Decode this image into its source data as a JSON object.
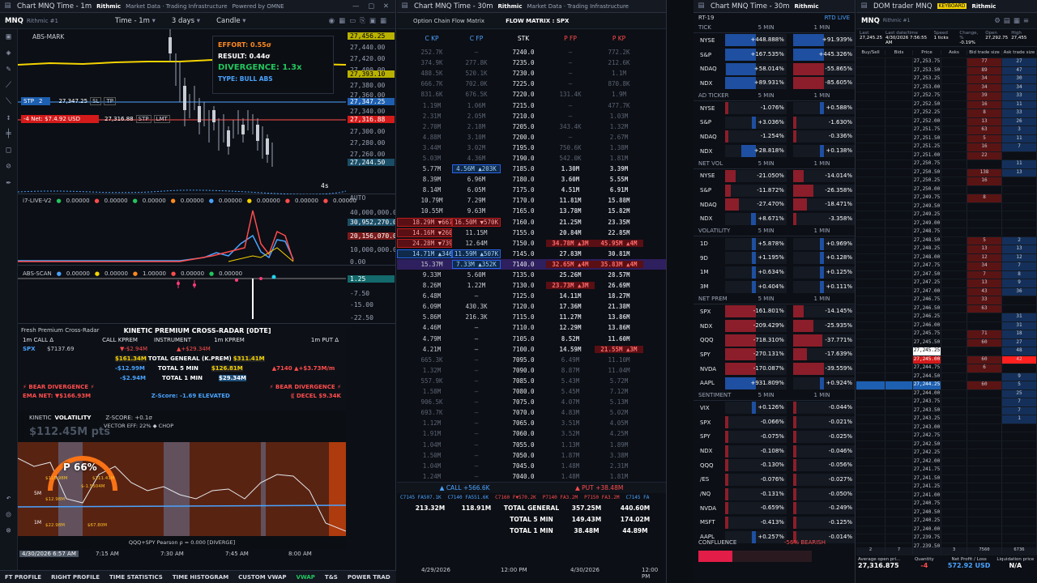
{
  "colors": {
    "accent": "#4aa3ff",
    "bear": "#ff4c4c",
    "bull": "#22c55e",
    "divergence": "#f5d300"
  },
  "left": {
    "title": "Chart MNQ Time - 1m",
    "brand": "Rithmic",
    "brand2": "Market Data · Trading Infrastructure",
    "powered": "Powered by OMNE",
    "symbol": "MNQ",
    "account": "Rithmic #1",
    "toolbar": {
      "interval": "Time - 1m",
      "range": "3 days",
      "style": "Candle"
    },
    "overlay": {
      "name": "ABS-MARK",
      "effort": "EFFORT: 0.55σ",
      "result": "RESULT: 0.44σ",
      "divergence": "DIVERGENCE: 1.3x",
      "type": "TYPE: BULL ABS"
    },
    "stp": {
      "label": "STP",
      "qty": "2",
      "price": "27,347.25",
      "sl": "SL",
      "tp": "TP"
    },
    "lmt": {
      "label": "-4 Net: $7.4.92 USD",
      "price": "27,316.88",
      "stp": "STP",
      "lmt": "LMT"
    },
    "price_axis": [
      "27,456.25",
      "27,440.00",
      "27,420.00",
      "27,400.00",
      "27,393.10",
      "27,380.00",
      "27,360.00",
      "27,347.25",
      "27,340.00",
      "27,316.88",
      "27,300.00",
      "27,280.00",
      "27,260.00",
      "27,244.50"
    ],
    "timer": "4s",
    "ind1": {
      "name": "i7-LIVE-V2",
      "values": [
        "0.00000",
        "0.00000",
        "0.00000",
        "0.00000",
        "0.00000",
        "0.00000",
        "0.00000",
        "0.00000"
      ],
      "axis": [
        "AUTO",
        "40,000,000.00",
        "30,952,270.00",
        "20,156,070.00",
        "10,000,000.00",
        "0.00",
        "AUTO"
      ]
    },
    "ind2": {
      "name": "ABS-SCAN",
      "values": [
        "0.00000",
        "0.00000",
        "1.00000",
        "0.00000",
        "0.00000"
      ],
      "axis": [
        "1.25",
        "-7.50",
        "-15.00",
        "-22.50"
      ]
    },
    "radar": {
      "window": "Fresh Premium Cross-Radar",
      "title": "KINETIC PREMIUM CROSS-RADAR [0DTE]",
      "headers": [
        "1m CALL Δ",
        "CALL KPREM",
        "INSTRUMENT",
        "1m KPREM",
        "1m PUT Δ"
      ],
      "spx_label": "SPX",
      "spx_price": "$7137.69",
      "r1c2": "▼-$2.94M",
      "r1c4": "▲+$29.34M",
      "gen_call": "$161.34M",
      "gen_label": "TOTAL GENERAL (K.PREM)",
      "gen_put": "$311.41M",
      "t5_call": "-$12.99M",
      "t5_label": "TOTAL 5 MIN",
      "t5_put": "$126.81M",
      "t5_right": "▲7140 ▲+$3.73M/m",
      "t1_call": "-$2.94M",
      "t1_label": "TOTAL 1 MIN",
      "t1_put": "$29.34M",
      "bear_left": "⚡ BEAR DIVERGENCE ⚡",
      "bear_right": "⚡ BEAR DIVERGENCE ⚡",
      "ema": "EMA NET: ▼$166.93M",
      "zscore": "Z-Score: -1.69 ELEVATED",
      "decel": "⟪ DECEL $9.34K"
    },
    "kinetic": {
      "label": "KINETIC",
      "vol": "VOLATILITY",
      "z": "Z-SCORE: +0.1σ",
      "eff": "VECTOR EFF: 22% ◆ CHOP",
      "pts": "$112.45M pts",
      "pct": "P 66%",
      "l5m": "5M",
      "l1m": "1M",
      "corr": "QQQ+SPY Pearson ρ = 0.000 [DIVERGE]",
      "anno": [
        "$115.98M",
        "$111.41M",
        "$-1.5504M",
        "$12.98M",
        "$22.98M",
        "$67.80M"
      ]
    },
    "time_axis": [
      "4/30/2026 6:57 AM",
      "7:15 AM",
      "7:30 AM",
      "7:45 AM",
      "8:00 AM"
    ]
  },
  "bottom_tabs": [
    "FT PROFILE",
    "RIGHT PROFILE",
    "TIME STATISTICS",
    "TIME HISTOGRAM",
    "CUSTOM VWAP",
    "VWAP",
    "T&S",
    "POWER TRAD"
  ],
  "matrix": {
    "title": "Chart MNQ Time - 30m",
    "window": "Option Chain Flow Matrix",
    "subtitle": "FLOW MATRIX : SPX",
    "headers": [
      "C KP",
      "C FP",
      "STK",
      "P FP",
      "P KP"
    ],
    "rows": [
      [
        "252.7K",
        "—",
        "7240.0",
        "—",
        "772.2K"
      ],
      [
        "374.9K",
        "277.8K",
        "7235.0",
        "—",
        "212.6K"
      ],
      [
        "488.5K",
        "520.1K",
        "7230.0",
        "—",
        "1.1M"
      ],
      [
        "666.7K",
        "702.0K",
        "7225.0",
        "—",
        "870.8K"
      ],
      [
        "831.6K",
        "676.5K",
        "7220.0",
        "131.4K",
        "1.9M"
      ],
      [
        "1.19M",
        "1.06M",
        "7215.0",
        "—",
        "477.7K"
      ],
      [
        "2.31M",
        "2.05M",
        "7210.0",
        "—",
        "1.03M"
      ],
      [
        "2.70M",
        "2.18M",
        "7205.0",
        "343.4K",
        "1.32M"
      ],
      [
        "4.88M",
        "3.10M",
        "7200.0",
        "—",
        "2.67M"
      ],
      [
        "3.44M",
        "3.02M",
        "7195.0",
        "750.6K",
        "1.38M"
      ],
      [
        "5.03M",
        "4.36M",
        "7190.0",
        "542.0K",
        "1.81M"
      ],
      [
        "5.77M",
        "4.56M ▲203K",
        "7185.0",
        "1.30M",
        "3.39M"
      ],
      [
        "8.39M",
        "6.96M",
        "7180.0",
        "3.60M",
        "5.55M"
      ],
      [
        "8.14M",
        "6.05M",
        "7175.0",
        "4.51M",
        "6.91M"
      ],
      [
        "10.79M",
        "7.29M",
        "7170.0",
        "11.81M",
        "15.88M"
      ],
      [
        "10.55M",
        "9.63M",
        "7165.0",
        "13.78M",
        "15.82M"
      ],
      [
        "18.29M ▼667K",
        "16.50M ▼570K",
        "7160.0",
        "21.25M",
        "23.35M"
      ],
      [
        "14.16M ▼260K",
        "11.15M",
        "7155.0",
        "20.84M",
        "22.85M"
      ],
      [
        "24.28M ▼739K",
        "12.64M",
        "7150.0",
        "34.78M ▲3M",
        "45.95M ▲4M"
      ],
      [
        "14.71M ▲346K",
        "11.59M ▲507K",
        "7145.0",
        "27.83M",
        "30.81M"
      ],
      [
        "15.37M",
        "7.33M ▲352K",
        "7140.0",
        "32.65M ▲4M",
        "35.83M ▲4M"
      ],
      [
        "9.33M",
        "5.60M",
        "7135.0",
        "25.26M",
        "28.57M"
      ],
      [
        "8.26M",
        "1.22M",
        "7130.0",
        "23.73M ▲3M",
        "26.69M"
      ],
      [
        "6.48M",
        "—",
        "7125.0",
        "14.11M",
        "18.27M"
      ],
      [
        "6.09M",
        "430.3K",
        "7120.0",
        "17.36M",
        "21.38M"
      ],
      [
        "5.86M",
        "216.3K",
        "7115.0",
        "11.27M",
        "13.86M"
      ],
      [
        "4.46M",
        "—",
        "7110.0",
        "12.29M",
        "13.86M"
      ],
      [
        "4.79M",
        "—",
        "7105.0",
        "8.52M",
        "11.60M"
      ],
      [
        "4.21M",
        "—",
        "7100.0",
        "14.59M",
        "21.55M ▲3M"
      ],
      [
        "665.3K",
        "—",
        "7095.0",
        "6.49M",
        "11.10M"
      ],
      [
        "1.32M",
        "—",
        "7090.0",
        "8.87M",
        "11.04M"
      ],
      [
        "557.9K",
        "—",
        "7085.0",
        "5.43M",
        "5.72M"
      ],
      [
        "1.58M",
        "—",
        "7080.0",
        "5.45M",
        "7.12M"
      ],
      [
        "906.5K",
        "—",
        "7075.0",
        "4.07M",
        "5.13M"
      ],
      [
        "693.7K",
        "—",
        "7070.0",
        "4.83M",
        "5.02M"
      ],
      [
        "1.12M",
        "—",
        "7065.0",
        "3.51M",
        "4.05M"
      ],
      [
        "1.91M",
        "—",
        "7060.0",
        "3.52M",
        "4.25M"
      ],
      [
        "1.04M",
        "—",
        "7055.0",
        "1.13M",
        "1.89M"
      ],
      [
        "1.50M",
        "—",
        "7050.0",
        "1.87M",
        "3.38M"
      ],
      [
        "1.04M",
        "—",
        "7045.0",
        "1.48M",
        "2.31M"
      ],
      [
        "1.24M",
        "—",
        "7040.0",
        "1.48M",
        "1.81M"
      ]
    ],
    "call_total": "▲ CALL +566.6K",
    "put_total": "▲ PUT +38.48M",
    "ticker": [
      "C7145 FA507.1K",
      "C7140 FA551.6K",
      "C7160 F▼570.2K",
      "P7140 FA3.2M",
      "P7150 FA3.2M",
      "C7145 FA"
    ],
    "totals": [
      {
        "c1": "213.32M",
        "c2": "118.91M",
        "label": "TOTAL GENERAL",
        "p1": "357.25M",
        "p2": "440.60M"
      },
      {
        "c1": "",
        "c2": "",
        "label": "TOTAL 5 MIN",
        "p1": "149.43M",
        "p2": "174.02M"
      },
      {
        "c1": "",
        "c2": "",
        "label": "TOTAL 1 MIN",
        "p1": "38.48M",
        "p2": "44.89M"
      }
    ],
    "time_axis": [
      "4/29/2026",
      "12:00 PM",
      "4/30/2026",
      "12:00 PM"
    ]
  },
  "dash": {
    "title": "Chart MNQ Time - 30m",
    "window": "RT-19",
    "live": "RTD LIVE",
    "col1": "5 MIN",
    "col2": "1 MIN",
    "sections": [
      {
        "name": "TICK",
        "rows": [
          [
            "NYSE",
            "+448.888%",
            "+91.939%"
          ],
          [
            "S&P",
            "+167.535%",
            "+445.326%"
          ],
          [
            "NDAQ",
            "+58.014%",
            "-55.865%"
          ],
          [
            "NDX",
            "+89.931%",
            "-85.605%"
          ]
        ]
      },
      {
        "name": "AD TICKER",
        "rows": [
          [
            "NYSE",
            "-1.076%",
            "+0.588%"
          ],
          [
            "S&P",
            "+3.036%",
            "-1.630%"
          ],
          [
            "NDAQ",
            "-1.254%",
            "-0.336%"
          ],
          [
            "NDX",
            "+28.818%",
            "+0.138%"
          ]
        ]
      },
      {
        "name": "NET VOL",
        "rows": [
          [
            "NYSE",
            "-21.050%",
            "-14.014%"
          ],
          [
            "S&P",
            "-11.872%",
            "-26.358%"
          ],
          [
            "NDAQ",
            "-27.470%",
            "-18.471%"
          ],
          [
            "NDX",
            "+8.671%",
            "-3.358%"
          ]
        ]
      },
      {
        "name": "VOLATILITY",
        "rows": [
          [
            "1D",
            "+5.878%",
            "+0.969%"
          ],
          [
            "9D",
            "+1.195%",
            "+0.128%"
          ],
          [
            "1M",
            "+0.634%",
            "+0.125%"
          ],
          [
            "3M",
            "+0.404%",
            "+0.111%"
          ]
        ]
      },
      {
        "name": "NET PREM",
        "rows": [
          [
            "SPX",
            "-161.801%",
            "-14.145%"
          ],
          [
            "NDX",
            "-209.429%",
            "-25.935%"
          ],
          [
            "QQQ",
            "-718.310%",
            "-37.771%"
          ],
          [
            "SPY",
            "-270.131%",
            "-17.639%"
          ],
          [
            "NVDA",
            "-170.087%",
            "-39.559%"
          ],
          [
            "AAPL",
            "+931.809%",
            "+0.924%"
          ]
        ]
      },
      {
        "name": "SENTIMENT",
        "rows": [
          [
            "VIX",
            "+0.126%",
            "-0.044%"
          ],
          [
            "SPX",
            "-0.066%",
            "-0.021%"
          ],
          [
            "SPY",
            "-0.075%",
            "-0.025%"
          ],
          [
            "NDX",
            "-0.108%",
            "-0.046%"
          ],
          [
            "QQQ",
            "-0.130%",
            "-0.056%"
          ],
          [
            "/ES",
            "-0.076%",
            "-0.027%"
          ],
          [
            "/NQ",
            "-0.131%",
            "-0.050%"
          ],
          [
            "NVDA",
            "-0.659%",
            "-0.249%"
          ],
          [
            "MSFT",
            "-0.413%",
            "-0.125%"
          ],
          [
            "AAPL",
            "+0.257%",
            "-0.014%"
          ]
        ]
      }
    ],
    "confluence": "CONFLUENCE",
    "conf_value": "-56% BEARISH"
  },
  "dom": {
    "title": "DOM trader MNQ",
    "keyboard": "KEYBOARD",
    "symbol": "MNQ",
    "account": "Rithmic #1",
    "info_labels": [
      "Last",
      "Last date/time",
      "Speed",
      "Change, %",
      "Open",
      "High"
    ],
    "info_values": [
      "27,245.25",
      "4/30/2026 7:56:55 AM",
      "1 ticks",
      "-0.19%",
      "27,292.75",
      "27,455"
    ],
    "headers": [
      "Buy/Sell",
      "Bids",
      "Price",
      "Asks",
      "Bid trade size",
      "Ask trade size"
    ],
    "prices": [
      "27,253.75",
      "27,253.50",
      "27,253.25",
      "27,253.00",
      "27,252.75",
      "27,252.50",
      "27,252.25",
      "27,252.00",
      "27,251.75",
      "27,251.50",
      "27,251.25",
      "27,251.00",
      "27,250.75",
      "27,250.50",
      "27,250.25",
      "27,250.00",
      "27,249.75",
      "27,249.50",
      "27,249.25",
      "27,249.00",
      "27,248.75",
      "27,248.50",
      "27,248.25",
      "27,248.00",
      "27,247.75",
      "27,247.50",
      "27,247.25",
      "27,247.00",
      "27,246.75",
      "27,246.50",
      "27,246.25",
      "27,246.00",
      "27,245.75",
      "27,245.50",
      "27,245.25",
      "27,245.00",
      "27,244.75",
      "27,244.50",
      "27,244.25",
      "27,244.00",
      "27,243.75",
      "27,243.50",
      "27,243.25",
      "27,243.00",
      "27,242.75",
      "27,242.50",
      "27,242.25",
      "27,242.00",
      "27,241.75",
      "27,241.50",
      "27,241.25",
      "27,241.00",
      "27,240.75",
      "27,240.50",
      "27,240.25",
      "27,240.00",
      "27,239.75",
      "27,239.50",
      "27,239.25",
      "27,239.00"
    ],
    "bid_sizes": [
      "77",
      "89",
      "34",
      "34",
      "39",
      "16",
      "8",
      "13",
      "63",
      "5",
      "16",
      "22",
      "",
      "138",
      "16",
      "",
      "8",
      "",
      "",
      "",
      "",
      "5",
      "13",
      "12",
      "34",
      "7",
      "13",
      "43",
      "33",
      "63",
      "",
      "",
      "71",
      "60",
      "",
      "60",
      "6",
      "",
      "60",
      "",
      "",
      "",
      "",
      "",
      "",
      "",
      "",
      "",
      "",
      "",
      "",
      "",
      "",
      "",
      "",
      "",
      "",
      "",
      "",
      ""
    ],
    "ask_sizes": [
      "27",
      "47",
      "30",
      "34",
      "33",
      "11",
      "33",
      "26",
      "3",
      "11",
      "7",
      "",
      "11",
      "13",
      "",
      "",
      "",
      "",
      "",
      "",
      "",
      "2",
      "13",
      "12",
      "7",
      "8",
      "9",
      "36",
      "",
      "",
      "31",
      "31",
      "18",
      "27",
      "48",
      "42",
      "",
      "9",
      "5",
      "25",
      "7",
      "7",
      "1",
      "",
      "",
      "",
      "",
      "",
      "",
      "",
      "",
      "",
      "",
      "",
      "",
      "",
      "",
      "",
      ""
    ],
    "footer_counts": [
      "2",
      "7",
      "",
      "3",
      "7560",
      "6736"
    ],
    "stats_labels": [
      "Average open pri...",
      "Quantity",
      "Net Profit / Loss",
      "Liquidation price"
    ],
    "stats_values": [
      "27,316.875",
      "-4",
      "572.92 USD",
      "N/A"
    ]
  }
}
